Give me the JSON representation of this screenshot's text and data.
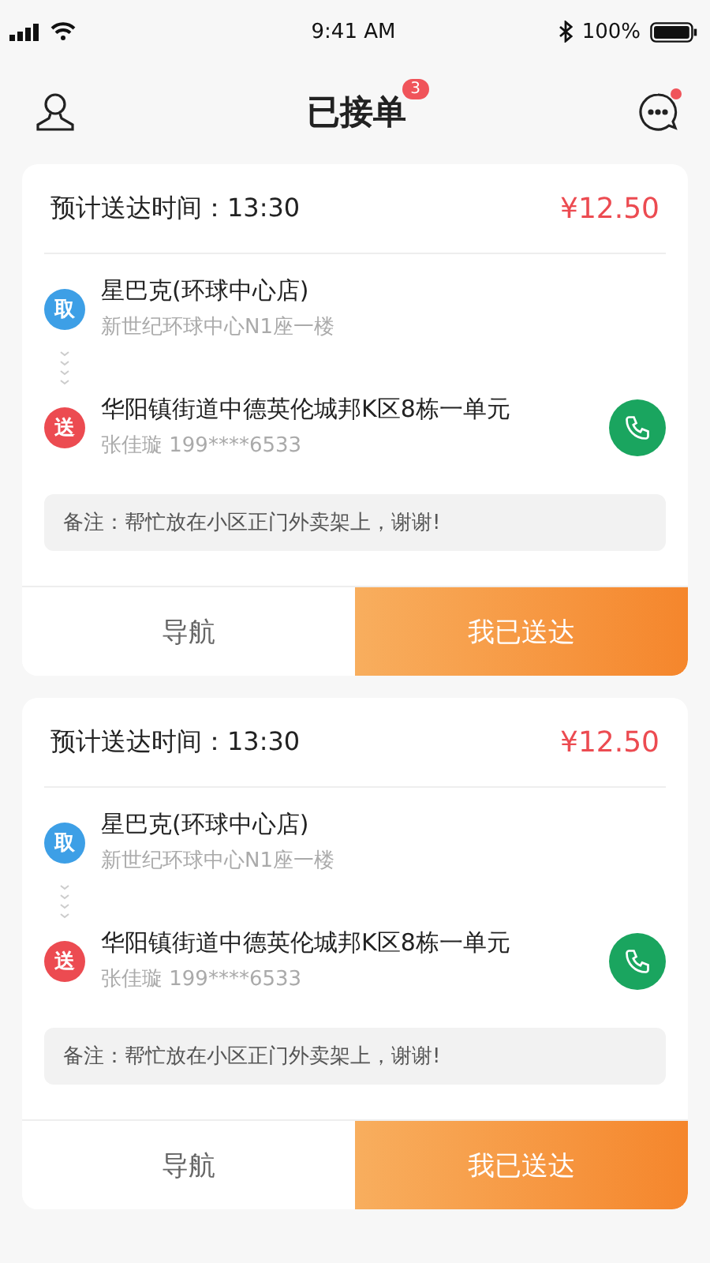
{
  "status_bar": {
    "time": "9:41 AM",
    "battery": "100%"
  },
  "header": {
    "title": "已接单",
    "badge": "3",
    "messages_unread": true
  },
  "orders": [
    {
      "eta_label": "预计送达时间：13:30",
      "price": "¥12.50",
      "stops": [
        {
          "kind": "pickup",
          "tag": "取",
          "color": "#3d9fe6",
          "name": "星巴克(环球中心店)",
          "detail": "新世纪环球中心N1座一楼",
          "call": false
        },
        {
          "kind": "dropoff",
          "tag": "送",
          "color": "#ec4b51",
          "name": "华阳镇街道中德英伦城邦K区8栋一单元",
          "detail": "张佳璇 199****6533",
          "call": true
        }
      ],
      "note": "备注：帮忙放在小区正门外卖架上，谢谢!",
      "actions": [
        "导航",
        "我已送达"
      ]
    },
    {
      "eta_label": "预计送达时间：13:30",
      "price": "¥12.50",
      "stops": [
        {
          "kind": "pickup",
          "tag": "取",
          "color": "#3d9fe6",
          "name": "星巴克(环球中心店)",
          "detail": "新世纪环球中心N1座一楼",
          "call": false
        },
        {
          "kind": "dropoff",
          "tag": "送",
          "color": "#ec4b51",
          "name": "华阳镇街道中德英伦城邦K区8栋一单元",
          "detail": "张佳璇 199****6533",
          "call": true
        }
      ],
      "note": "备注：帮忙放在小区正门外卖架上，谢谢!",
      "actions": [
        "导航",
        "我已送达"
      ]
    }
  ]
}
